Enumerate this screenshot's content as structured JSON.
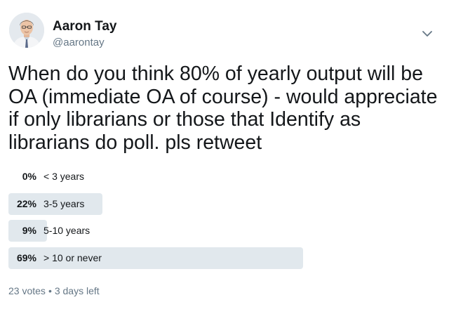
{
  "author": {
    "name": "Aaron Tay",
    "handle": "@aarontay"
  },
  "icons": {
    "avatar": "avatar-photo",
    "menu": "chevron-down-icon"
  },
  "tweet": {
    "text": "When do you think 80% of yearly output will be OA (immediate OA of course) - would appreciate if only librarians or those that Identify as librarians do poll. pls retweet"
  },
  "poll": {
    "options": [
      {
        "percent_label": "0%",
        "label": "< 3 years",
        "fraction": 0.0
      },
      {
        "percent_label": "22%",
        "label": "3-5 years",
        "fraction": 0.22
      },
      {
        "percent_label": "9%",
        "label": "5-10 years",
        "fraction": 0.09
      },
      {
        "percent_label": "69%",
        "label": "> 10 or never",
        "fraction": 0.69
      }
    ],
    "votes": "23 votes",
    "time_left": "3 days left",
    "separator": "•"
  },
  "colors": {
    "bar": "#e1e8ed",
    "text": "#14171a",
    "secondary_text": "#657786"
  }
}
